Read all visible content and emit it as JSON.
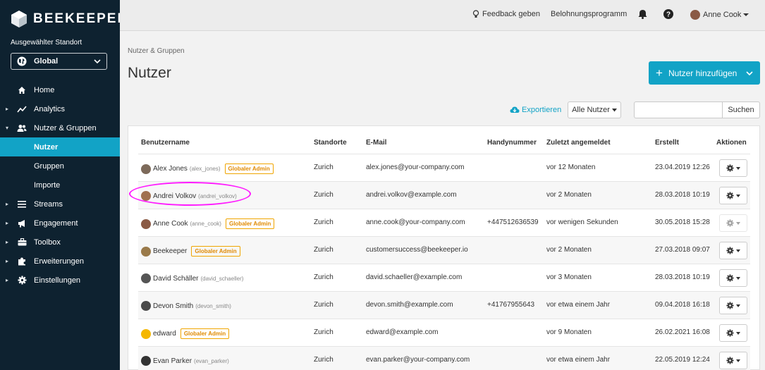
{
  "brand": {
    "name": "BEEKEEPER"
  },
  "location": {
    "label": "Ausgewählter Standort",
    "value": "Global"
  },
  "nav": [
    {
      "label": "Home",
      "icon": "home-icon",
      "caret": ""
    },
    {
      "label": "Analytics",
      "icon": "analytics-icon",
      "caret": "▸"
    },
    {
      "label": "Nutzer & Gruppen",
      "icon": "users-icon",
      "caret": "▾"
    },
    {
      "label": "Nutzer",
      "icon": "",
      "caret": ""
    },
    {
      "label": "Gruppen",
      "icon": "",
      "caret": ""
    },
    {
      "label": "Importe",
      "icon": "",
      "caret": ""
    },
    {
      "label": "Streams",
      "icon": "streams-icon",
      "caret": "▸"
    },
    {
      "label": "Engagement",
      "icon": "megaphone-icon",
      "caret": "▸"
    },
    {
      "label": "Toolbox",
      "icon": "toolbox-icon",
      "caret": "▸"
    },
    {
      "label": "Erweiterungen",
      "icon": "puzzle-icon",
      "caret": "▸"
    },
    {
      "label": "Einstellungen",
      "icon": "gear-icon",
      "caret": "▸"
    }
  ],
  "topbar": {
    "feedback": "Feedback geben",
    "rewards": "Belohnungsprogramm",
    "user": "Anne Cook"
  },
  "breadcrumb": "Nutzer & Gruppen",
  "page_title": "Nutzer",
  "add_button": "Nutzer hinzufügen",
  "toolbar": {
    "export": "Exportieren",
    "filter": "Alle Nutzer",
    "search_placeholder": "",
    "search_button": "Suchen"
  },
  "table": {
    "columns": [
      "Benutzername",
      "Standorte",
      "E-Mail",
      "Handynummer",
      "Zuletzt angemeldet",
      "Erstellt",
      "Aktionen"
    ],
    "rows": [
      {
        "name": "Alex Jones",
        "handle": "(alex_jones)",
        "badge": "Globaler Admin",
        "location": "Zurich",
        "email": "alex.jones@your-company.com",
        "phone": "",
        "last_login": "vor 12 Monaten",
        "created": "23.04.2019 12:26",
        "action_disabled": false
      },
      {
        "name": "Andrei Volkov",
        "handle": "(andrei_volkov)",
        "badge": "",
        "location": "Zurich",
        "email": "andrei.volkov@example.com",
        "phone": "",
        "last_login": "vor 2 Monaten",
        "created": "28.03.2018 10:19",
        "action_disabled": false
      },
      {
        "name": "Anne Cook",
        "handle": "(anne_cook)",
        "badge": "Globaler Admin",
        "location": "Zurich",
        "email": "anne.cook@your-company.com",
        "phone": "+447512636539",
        "last_login": "vor wenigen Sekunden",
        "created": "30.05.2018 15:28",
        "action_disabled": true
      },
      {
        "name": "Beekeeper",
        "handle": "",
        "badge": "Globaler Admin",
        "location": "Zurich",
        "email": "customersuccess@beekeeper.io",
        "phone": "",
        "last_login": "vor 2 Monaten",
        "created": "27.03.2018 09:07",
        "action_disabled": false
      },
      {
        "name": "David Schäller",
        "handle": "(david_schaeller)",
        "badge": "",
        "location": "Zurich",
        "email": "david.schaeller@example.com",
        "phone": "",
        "last_login": "vor 3 Monaten",
        "created": "28.03.2018 10:19",
        "action_disabled": false
      },
      {
        "name": "Devon Smith",
        "handle": "(devon_smith)",
        "badge": "",
        "location": "Zurich",
        "email": "devon.smith@example.com",
        "phone": "+41767955643",
        "last_login": "vor etwa einem Jahr",
        "created": "09.04.2018 16:18",
        "action_disabled": false
      },
      {
        "name": "edward",
        "handle": "",
        "badge": "Globaler Admin",
        "location": "Zurich",
        "email": "edward@example.com",
        "phone": "",
        "last_login": "vor 9 Monaten",
        "created": "26.02.2021 16:08",
        "action_disabled": false
      },
      {
        "name": "Evan Parker",
        "handle": "(evan_parker)",
        "badge": "",
        "location": "Zurich",
        "email": "evan.parker@your-company.com",
        "phone": "",
        "last_login": "vor etwa einem Jahr",
        "created": "22.05.2019 12:24",
        "action_disabled": false
      }
    ]
  },
  "colors": {
    "sidebar": "#0e2230",
    "accent": "#12a3c6",
    "badge": "#f0a500",
    "highlight": "#ff1bff"
  }
}
